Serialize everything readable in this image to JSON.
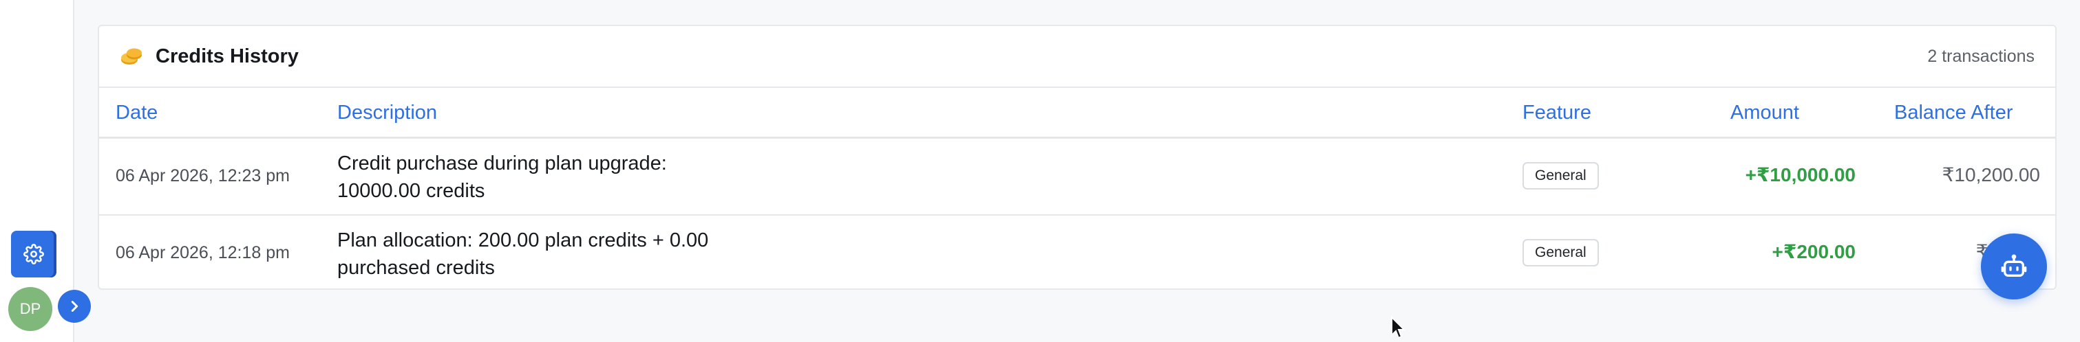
{
  "sidebar": {
    "settings_icon": "gear-icon",
    "avatar_initials": "DP",
    "expand_icon": "chevron-right-icon"
  },
  "credits_history": {
    "title": "Credits History",
    "title_icon": "coins-icon",
    "transaction_count": "2 transactions",
    "columns": {
      "date": "Date",
      "description": "Description",
      "feature": "Feature",
      "amount": "Amount",
      "balance_after": "Balance After"
    },
    "rows": [
      {
        "date": "06 Apr 2026, 12:23 pm",
        "description_line1": "Credit purchase during plan upgrade:",
        "description_line2": "10000.00 credits",
        "feature": "General",
        "amount": "+₹10,000.00",
        "balance_after": "₹10,200.00"
      },
      {
        "date": "06 Apr 2026, 12:18 pm",
        "description_line1": "Plan allocation: 200.00 plan credits + 0.00",
        "description_line2": "purchased credits",
        "feature": "General",
        "amount": "+₹200.00",
        "balance_after": "₹2"
      }
    ]
  },
  "assistant_button": {
    "icon": "robot-icon"
  },
  "colors": {
    "accent": "#2f6fe4",
    "positive_amount": "#2f9e44",
    "avatar_bg": "#7fb87a",
    "page_bg": "#f7f8fa"
  }
}
